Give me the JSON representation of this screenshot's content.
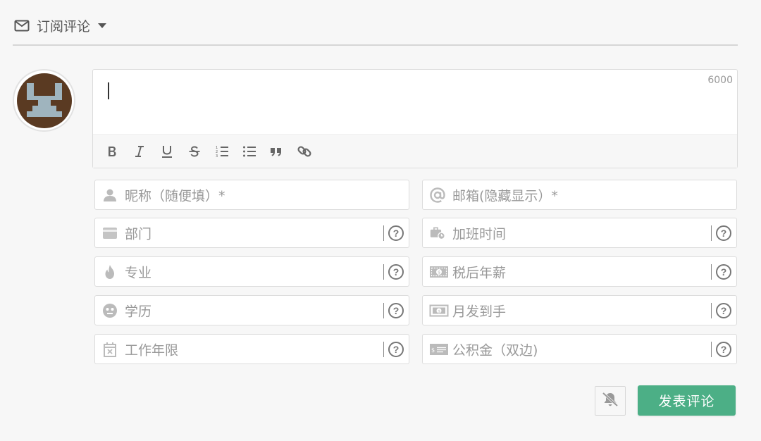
{
  "header": {
    "subscribe_label": "订阅评论",
    "subscribe_icon": "envelope-icon",
    "dropdown_icon": "caret-down-icon"
  },
  "editor": {
    "char_limit": "6000",
    "toolbar": [
      "bold-icon",
      "italic-icon",
      "underline-icon",
      "strikethrough-icon",
      "ordered-list-icon",
      "bullet-list-icon",
      "quote-icon",
      "link-icon"
    ]
  },
  "fields": {
    "nickname": "昵称（随便填）*",
    "email": "邮箱(隐藏显示）*",
    "department": "部门",
    "overtime": "加班时间",
    "major": "专业",
    "salary": "税后年薪",
    "education": "学历",
    "monthly": "月发到手",
    "years": "工作年限",
    "fund": "公积金（双边)"
  },
  "help_label": "?",
  "actions": {
    "submit_label": "发表评论",
    "mute_icon": "bell-off-icon"
  },
  "colors": {
    "accent": "#4caf86",
    "background": "#f7f7f7"
  }
}
